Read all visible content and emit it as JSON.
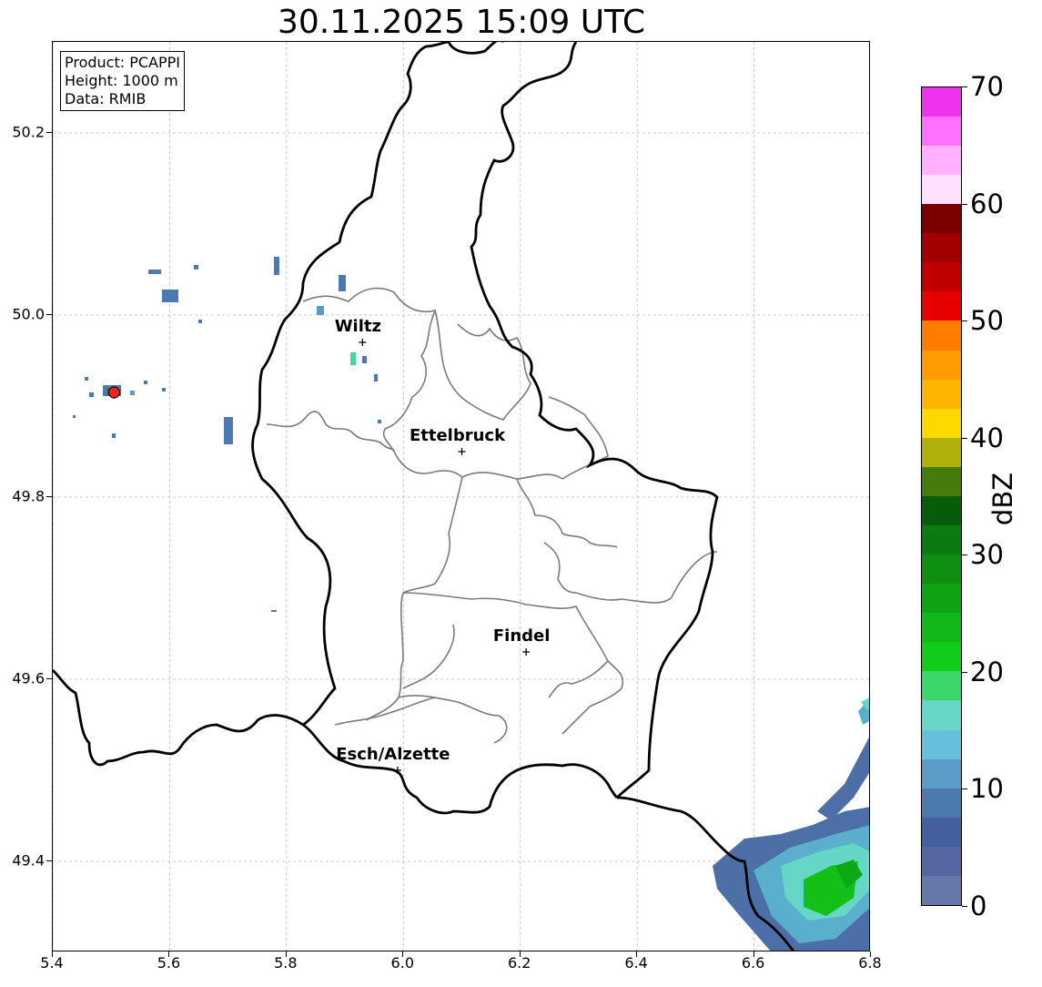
{
  "title": "30.11.2025 15:09 UTC",
  "info": {
    "lines": [
      "Product: PCAPPI",
      "Height: 1000 m",
      "Data: RMIB"
    ]
  },
  "map": {
    "lon_range": [
      5.4,
      6.8
    ],
    "lat_range": [
      49.3,
      50.3
    ],
    "x_ticks": [
      "5.4",
      "5.6",
      "5.8",
      "6.0",
      "6.2",
      "6.4",
      "6.6",
      "6.8"
    ],
    "y_ticks": [
      "49.4",
      "49.6",
      "49.8",
      "50.0",
      "50.2"
    ],
    "grid": true,
    "radar_site": {
      "lon": 5.505,
      "lat": 49.915,
      "color": "#ff2020"
    },
    "cities": [
      {
        "name": "Wiltz",
        "lon": 5.93,
        "lat": 49.97
      },
      {
        "name": "Ettelbruck",
        "lon": 6.1,
        "lat": 49.85
      },
      {
        "name": "Findel",
        "lon": 6.21,
        "lat": 49.63
      },
      {
        "name": "Esch/Alzette",
        "lon": 5.99,
        "lat": 49.5
      }
    ]
  },
  "colorbar": {
    "label": "dBZ",
    "min": 0,
    "max": 70,
    "step": 2.5,
    "ticks": [
      "0",
      "10",
      "20",
      "30",
      "40",
      "50",
      "60",
      "70"
    ],
    "colors": [
      "#6677aa",
      "#5566a3",
      "#445f9f",
      "#4c7ab0",
      "#5a9cc7",
      "#66c0dc",
      "#66d6c6",
      "#3dd66a",
      "#12cc1c",
      "#12b81a",
      "#10a414",
      "#0e8f12",
      "#0b7a10",
      "#075c0a",
      "#467c0e",
      "#b0b00c",
      "#ffd800",
      "#ffb400",
      "#ff9c00",
      "#ff7c00",
      "#e80000",
      "#c00000",
      "#a00000",
      "#7a0000",
      "#ffe0ff",
      "#ffb0ff",
      "#ff70ff",
      "#ee33ee"
    ]
  }
}
